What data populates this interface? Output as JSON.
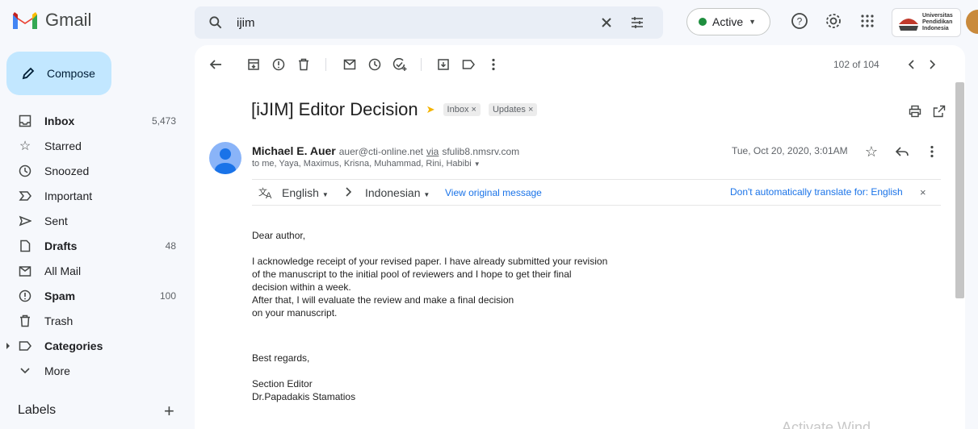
{
  "app": {
    "name": "Gmail"
  },
  "search": {
    "query": "ijim"
  },
  "status": {
    "label": "Active"
  },
  "org": {
    "line1": "Universitas",
    "line2": "Pendidikan",
    "line3": "Indonesia"
  },
  "compose": {
    "label": "Compose"
  },
  "nav": [
    {
      "label": "Inbox",
      "count": "5,473",
      "bold": true,
      "icon": "inbox-icon"
    },
    {
      "label": "Starred",
      "count": "",
      "bold": false,
      "icon": "star-icon"
    },
    {
      "label": "Snoozed",
      "count": "",
      "bold": false,
      "icon": "clock-icon"
    },
    {
      "label": "Important",
      "count": "",
      "bold": false,
      "icon": "important-icon"
    },
    {
      "label": "Sent",
      "count": "",
      "bold": false,
      "icon": "send-icon"
    },
    {
      "label": "Drafts",
      "count": "48",
      "bold": true,
      "icon": "draft-icon"
    },
    {
      "label": "All Mail",
      "count": "",
      "bold": false,
      "icon": "all-mail-icon"
    },
    {
      "label": "Spam",
      "count": "100",
      "bold": true,
      "icon": "spam-icon"
    },
    {
      "label": "Trash",
      "count": "",
      "bold": false,
      "icon": "trash-icon"
    },
    {
      "label": "Categories",
      "count": "",
      "bold": true,
      "icon": "label-icon"
    },
    {
      "label": "More",
      "count": "",
      "bold": false,
      "icon": "chevron-down-icon"
    }
  ],
  "labels": {
    "title": "Labels"
  },
  "pager": {
    "text": "102 of 104"
  },
  "email": {
    "subject": "[iJIM] Editor Decision",
    "chips": [
      "Inbox",
      "Updates"
    ],
    "sender_name": "Michael E. Auer",
    "sender_email": "auer@cti-online.net",
    "via_label": "via",
    "via_host": "sfulib8.nmsrv.com",
    "to": "to me, Yaya, Maximus, Krisna, Muhammad, Rini, Habibi",
    "date": "Tue, Oct 20, 2020, 3:01AM",
    "body": {
      "greeting": "Dear author,",
      "p1_l1": "I acknowledge receipt of your revised paper. I have already submitted your revision",
      "p1_l2": "of the manuscript to the initial pool of reviewers and I hope to get their final",
      "p1_l3": "decision within a week.",
      "p1_l4": "After that, I will evaluate the review and make a final decision",
      "p1_l5": "on your manuscript.",
      "closing": "Best regards,",
      "sig1": "Section Editor",
      "sig2": "Dr.Papadakis Stamatios"
    }
  },
  "translate": {
    "from": "English",
    "to": "Indonesian",
    "view_original": "View original message",
    "dont_translate": "Don't automatically translate for: English"
  },
  "watermark": {
    "text": "Activate Wind"
  }
}
